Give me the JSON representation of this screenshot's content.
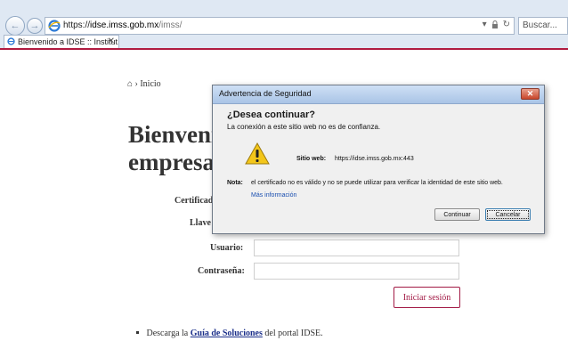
{
  "browser": {
    "url_scheme": "https://",
    "url_host": "idse.imss.gob.mx",
    "url_path": "/imss/",
    "search_placeholder": "Buscar...",
    "tab_title": "Bienvenido a IDSE :: Institut...",
    "tab_close": "✕",
    "accent_color": "#b01b40"
  },
  "page": {
    "breadcrumb": "› Inicio",
    "title_line1": "Bienveni",
    "title_line2": "empresa",
    "labels": {
      "certificado": "Certificado",
      "llave": "Llave",
      "usuario": "Usuario:",
      "contrasena": "Contraseña:"
    },
    "login_button": "Iniciar sesión",
    "note_prefix": "Descarga la",
    "note_link": "Guía de Soluciones",
    "note_suffix": "del portal IDSE.",
    "accent_color": "#a21a45"
  },
  "dialog": {
    "title": "Advertencia de Seguridad",
    "close": "✕",
    "heading": "¿Desea continuar?",
    "subheading": "La conexión a este sitio web no es de confianza.",
    "site_label": "Sitio web:",
    "site_value": "https://idse.imss.gob.mx:443",
    "note_label": "Nota:",
    "note_text": "el certificado no es válido y no se puede utilizar para verificar la identidad de este sitio web.",
    "more_info": "Más información",
    "continue_button": "Continuar",
    "cancel_button": "Cancelar",
    "icons": [
      "warning-icon"
    ]
  }
}
